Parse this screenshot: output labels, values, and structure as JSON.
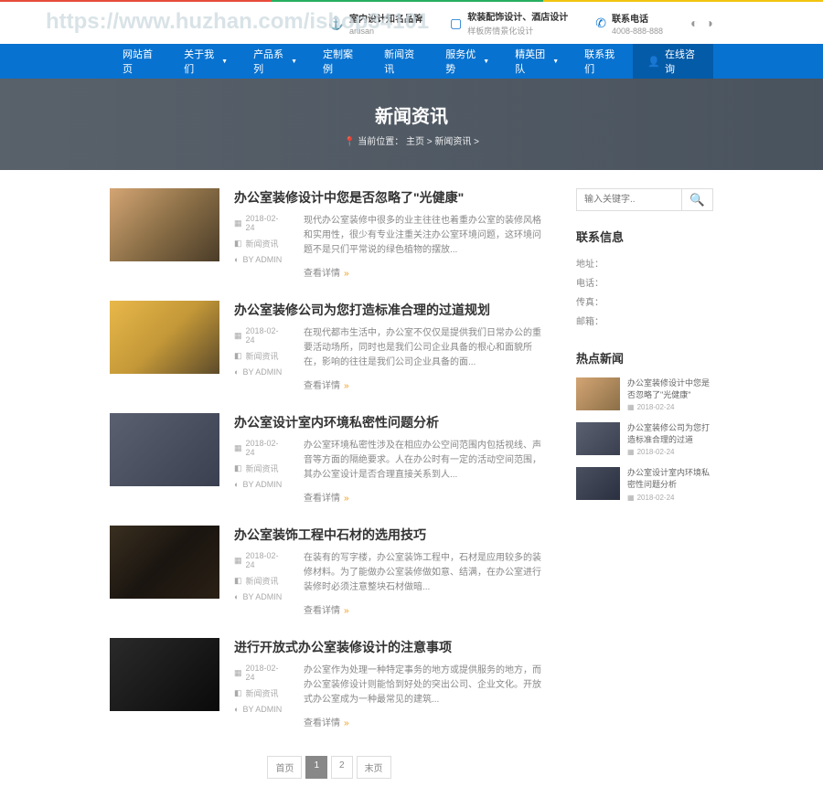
{
  "watermark": "https://www.huzhan.com/ishop34101",
  "topbar": {
    "brand": {
      "title": "室内设计知名品牌",
      "sub": "artisan"
    },
    "design": {
      "title": "软装配饰设计、酒店设计",
      "sub": "样板房情景化设计"
    },
    "phone": {
      "title": "联系电话",
      "sub": "4008-888-888"
    }
  },
  "nav": {
    "items": [
      {
        "label": "网站首页",
        "caret": false
      },
      {
        "label": "关于我们",
        "caret": true
      },
      {
        "label": "产品系列",
        "caret": true
      },
      {
        "label": "定制案例",
        "caret": false
      },
      {
        "label": "新闻资讯",
        "caret": false
      },
      {
        "label": "服务优势",
        "caret": true
      },
      {
        "label": "精英团队",
        "caret": true
      },
      {
        "label": "联系我们",
        "caret": false
      }
    ],
    "chat": "在线咨询"
  },
  "banner": {
    "title": "新闻资讯",
    "breadcrumb_label": "当前位置：",
    "bc_home": "主页",
    "bc_sep": " > ",
    "bc_current": "新闻资讯 >"
  },
  "articles": [
    {
      "title": "办公室装修设计中您是否忽略了\"光健康\"",
      "date": "2018-02-24",
      "category": "新闻资讯",
      "author": "BY ADMIN",
      "excerpt": "现代办公室装修中很多的业主往往也着重办公室的装修风格和实用性，很少有专业注重关注办公室环境问题，这环境问题不是只们平常说的绿色植物的摆放...",
      "more": "查看详情"
    },
    {
      "title": "办公室装修公司为您打造标准合理的过道规划",
      "date": "2018-02-24",
      "category": "新闻资讯",
      "author": "BY ADMIN",
      "excerpt": "在现代都市生活中，办公室不仅仅是提供我们日常办公的重要活动场所，同时也是我们公司企业具备的根心和面貌所在，影响的往往是我们公司企业具备的面...",
      "more": "查看详情"
    },
    {
      "title": "办公室设计室内环境私密性问题分析",
      "date": "2018-02-24",
      "category": "新闻资讯",
      "author": "BY ADMIN",
      "excerpt": "办公室环境私密性涉及在相应办公空间范围内包括视线、声音等方面的隔绝要求。人在办公时有一定的活动空间范围，其办公室设计是否合理直接关系到人...",
      "more": "查看详情"
    },
    {
      "title": "办公室装饰工程中石材的选用技巧",
      "date": "2018-02-24",
      "category": "新闻资讯",
      "author": "BY ADMIN",
      "excerpt": "在装有的写字楼，办公室装饰工程中，石材是应用较多的装修材料。为了能做办公室装修做如意、结满，在办公室进行装修时必须注意整块石材做暗...",
      "more": "查看详情"
    },
    {
      "title": "进行开放式办公室装修设计的注意事项",
      "date": "2018-02-24",
      "category": "新闻资讯",
      "author": "BY ADMIN",
      "excerpt": "办公室作为处理一种特定事务的地方或提供服务的地方，而办公室装修设计则能恰到好处的突出公司、企业文化。开放式办公室成为一种最常见的建筑...",
      "more": "查看详情"
    }
  ],
  "pagination": {
    "first": "首页",
    "p1": "1",
    "p2": "2",
    "last": "末页"
  },
  "sidebar": {
    "search_placeholder": "输入关键字..",
    "contact_h": "联系信息",
    "contact": {
      "addr": "地址：",
      "tel": "电话：",
      "fax": "传真：",
      "mail": "邮箱："
    },
    "hot_h": "热点新闻",
    "hot": [
      {
        "title": "办公室装修设计中您是否忽略了\"光健康\"",
        "date": "2018-02-24"
      },
      {
        "title": "办公室装修公司为您打造标准合理的过道",
        "date": "2018-02-24"
      },
      {
        "title": "办公室设计室内环境私密性问题分析",
        "date": "2018-02-24"
      }
    ]
  }
}
